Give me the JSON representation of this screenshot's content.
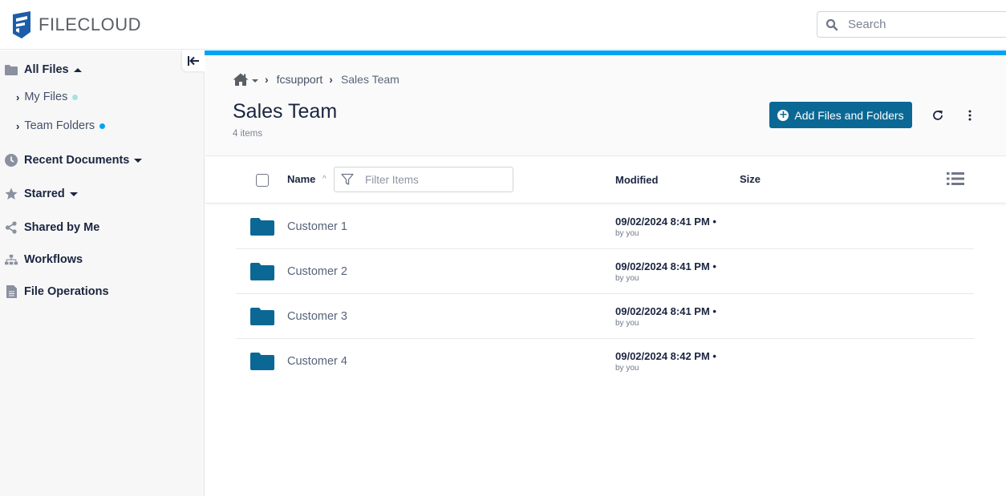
{
  "app": {
    "brand": "FILECLOUD",
    "brand_color": "#1d5ea8",
    "accent_color": "#0b6895",
    "progress_color": "#03a3f4"
  },
  "search": {
    "placeholder": "Search",
    "value": ""
  },
  "sidebar": {
    "collapse_icon": "collapse-left-icon",
    "all_files": {
      "label": "All Files",
      "icon": "folder-icon",
      "expanded": true
    },
    "sub_items": [
      {
        "label": "My Files",
        "dot_color": "#a6e3e3"
      },
      {
        "label": "Team Folders",
        "dot_color": "#03a3f4"
      }
    ],
    "items": [
      {
        "label": "Recent Documents",
        "icon": "clock-icon",
        "has_caret": true
      },
      {
        "label": "Starred",
        "icon": "star-icon",
        "has_caret": true
      },
      {
        "label": "Shared by Me",
        "icon": "share-icon",
        "has_caret": false
      },
      {
        "label": "Workflows",
        "icon": "workflow-icon",
        "has_caret": false
      },
      {
        "label": "File Operations",
        "icon": "document-icon",
        "has_caret": false
      }
    ]
  },
  "breadcrumb": {
    "home_icon": "home-icon",
    "items": [
      "fcsupport",
      "Sales Team"
    ]
  },
  "page": {
    "title": "Sales Team",
    "item_count": "4 items",
    "add_button": "Add Files and Folders"
  },
  "table": {
    "columns": {
      "name": "Name",
      "modified": "Modified",
      "size": "Size"
    },
    "filter_placeholder": "Filter Items",
    "rows": [
      {
        "name": "Customer 1",
        "modified": "09/02/2024 8:41 PM •",
        "by": "by you",
        "size": ""
      },
      {
        "name": "Customer 2",
        "modified": "09/02/2024 8:41 PM •",
        "by": "by you",
        "size": ""
      },
      {
        "name": "Customer 3",
        "modified": "09/02/2024 8:41 PM •",
        "by": "by you",
        "size": ""
      },
      {
        "name": "Customer 4",
        "modified": "09/02/2024 8:42 PM •",
        "by": "by you",
        "size": ""
      }
    ]
  }
}
